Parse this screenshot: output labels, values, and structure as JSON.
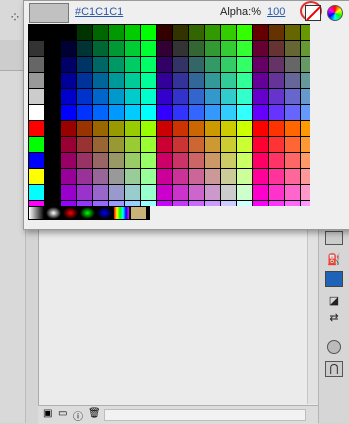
{
  "color_picker": {
    "current_hex": "#C1C1C1",
    "current_color": "#c1c1c1",
    "alpha_label": "Alpha:%",
    "alpha_value": "100",
    "no_color_icon": "no-color-icon",
    "color_wheel_icon": "color-wheel-icon"
  },
  "palette": {
    "left_column_1": [
      "#000000",
      "#333333",
      "#666666",
      "#999999",
      "#cccccc",
      "#ffffff",
      "#ff0000",
      "#00ff00",
      "#0000ff",
      "#ffff00",
      "#00ffff",
      "#ff00ff"
    ],
    "left_column_2": [
      "#000000",
      "#000000",
      "#000000",
      "#000000",
      "#000000",
      "#000000",
      "#000000",
      "#000000",
      "#000000",
      "#000000",
      "#000000",
      "#000000"
    ],
    "gradients": [
      "grayscale-linear",
      "grayscale-radial",
      "red-radial",
      "green-radial",
      "blue-radial",
      "rainbow-linear",
      "bitmap-fill"
    ]
  },
  "tools": [
    "stroke-color-icon",
    "paint-bucket-icon",
    "fill-color-swatch",
    "swap-colors-icon",
    "black-white-icon",
    "object-drawing-icon",
    "snap-magnet-icon"
  ],
  "library": [
    "new-symbol-icon",
    "new-folder-icon",
    "properties-icon",
    "delete-icon"
  ]
}
